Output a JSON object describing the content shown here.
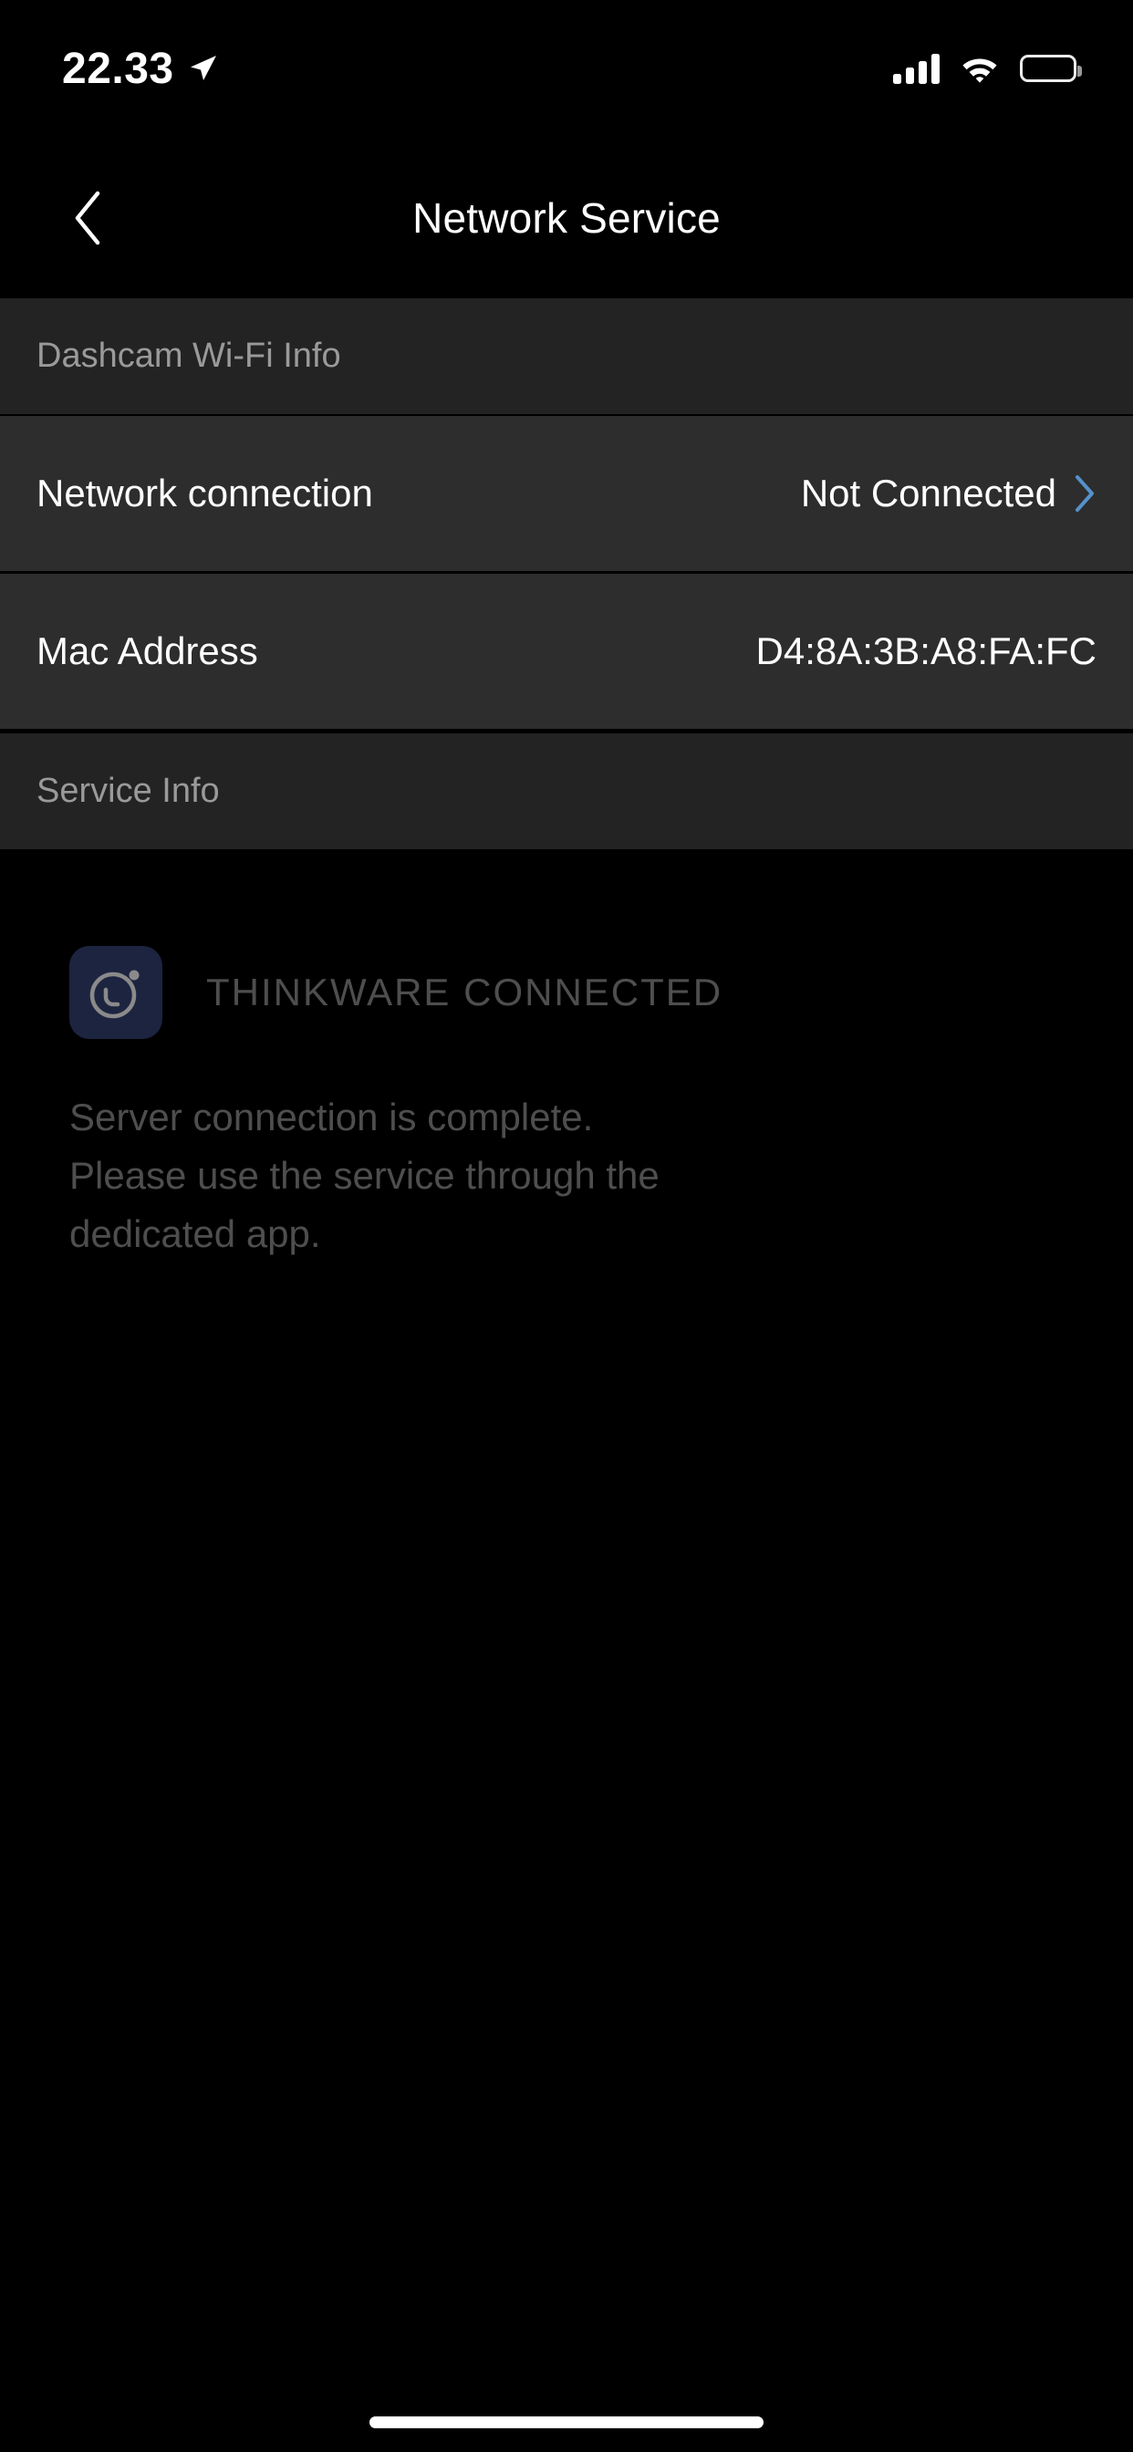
{
  "status_bar": {
    "time": "22.33",
    "location_icon": "location-arrow-icon",
    "cellular_icon": "cellular-signal-icon",
    "cellular_bars": 4,
    "wifi_icon": "wifi-icon",
    "battery_icon": "battery-full-icon",
    "battery_level": 100
  },
  "nav": {
    "back_icon": "chevron-left-icon",
    "title": "Network Service"
  },
  "sections": [
    {
      "header": "Dashcam Wi-Fi Info",
      "rows": [
        {
          "label": "Network connection",
          "value": "Not Connected",
          "chevron_icon": "chevron-right-icon",
          "has_chevron": true
        },
        {
          "label": "Mac Address",
          "value": "D4:8A:3B:A8:FA:FC",
          "has_chevron": false
        }
      ]
    },
    {
      "header": "Service Info",
      "rows": []
    }
  ],
  "service_info": {
    "logo_icon": "thinkware-dashcam-lens-icon",
    "brand_name": "THINKWARE CONNECTED",
    "description": "Server connection is complete.\nPlease use the service through the\ndedicated app."
  },
  "home_indicator": "home-indicator-bar",
  "colors": {
    "background": "#000000",
    "section_header_bg": "#232323",
    "row_bg": "#2d2d2d",
    "divider": "#000000",
    "primary_text": "#ffffff",
    "secondary_text": "#9a9a9a",
    "muted_text": "#4e4e4e",
    "accent_chevron": "#5591cc",
    "logo_bg": "#1d2440",
    "logo_fg": "#8a8a8a"
  }
}
